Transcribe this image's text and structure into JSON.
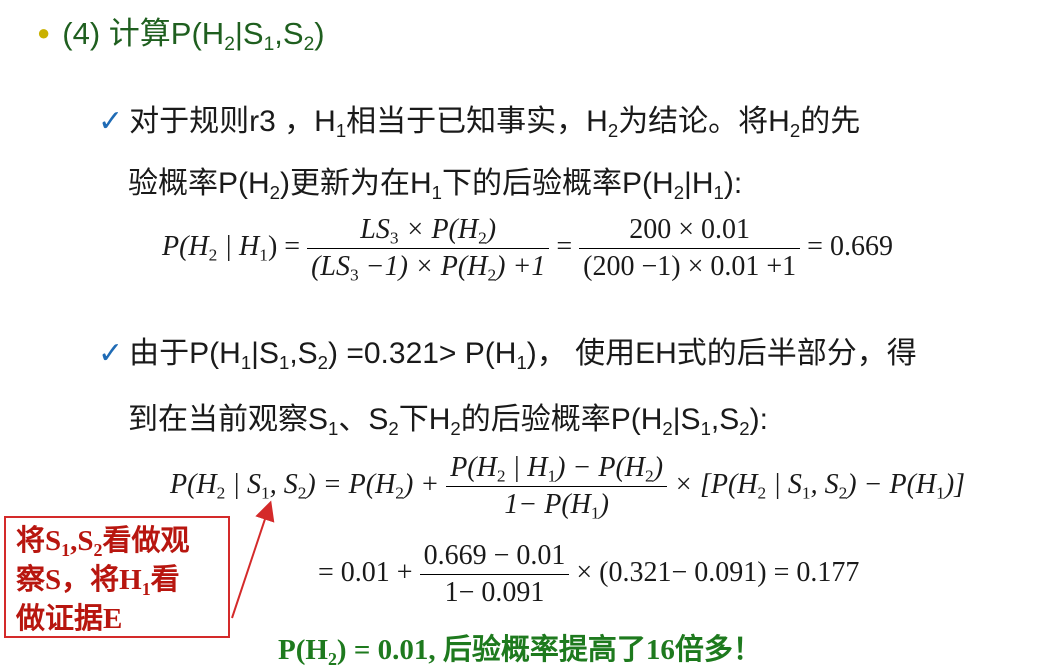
{
  "title": {
    "text_prefix": "(4) 计算P(H",
    "s1": "1",
    "s2": "2",
    "h2": "2",
    "open": "|S",
    "comma": ",S",
    "close": ")"
  },
  "para1": {
    "line1_a": "对于规则r3 ，H",
    "line1_b": "相当于已知事实，H",
    "line1_c": "为结论。将H",
    "line1_d": "的先",
    "line2_a": "验概率P(H",
    "line2_b": ")更新为在H",
    "line2_c": "下的后验概率P(H",
    "line2_d": "|H",
    "line2_e": "):",
    "sub1": "1",
    "sub2": "2"
  },
  "eq1": {
    "lhs": "P(H",
    "lhs_mid": " | H",
    "lhs_end": ") =",
    "num1": "LS",
    "num1_b": " × P(H",
    "num1_c": ")",
    "den1_a": "(LS",
    "den1_b": " −1) × P(H",
    "den1_c": ") +1",
    "eq_sign": "=",
    "num2": "200 × 0.01",
    "den2": "(200 −1) × 0.01 +1",
    "result": "= 0.669",
    "sub3": "3"
  },
  "para2": {
    "line1_a": "由于P(H",
    "line1_b": "|S",
    "line1_c": ",S",
    "line1_d": ") =0.321> P(H",
    "line1_e": ")， 使用EH式的后半部分，得",
    "line2_a": "到在当前观察S",
    "line2_b": "、S",
    "line2_c": "下H",
    "line2_d": "的后验概率P(H",
    "line2_e": "|S",
    "line2_f": ",S",
    "line2_g": "):"
  },
  "eq2": {
    "lhs": "P(H",
    "lhs_b": " | S",
    "lhs_c": ", S",
    "lhs_d": ") = P(H",
    "lhs_e": ") +",
    "num_a": "P(H",
    "num_b": " | H",
    "num_c": ") − P(H",
    "num_d": ")",
    "den_a": "1− P(H",
    "den_b": ")",
    "tail_a": "× [P(H",
    "tail_b": " | S",
    "tail_c": ", S",
    "tail_d": ") − P(H",
    "tail_e": ")]"
  },
  "eq3": {
    "pre": "= 0.01 +",
    "num": "0.669 − 0.01",
    "den": "1− 0.091",
    "post": "× (0.321− 0.091) = 0.177"
  },
  "note": {
    "line1_a": "将S",
    "line1_b": ",S",
    "line1_c": "看做观",
    "line2_a": "察S，将H",
    "line2_b": "看",
    "line3": "做证据E"
  },
  "conclusion": {
    "a": "P(H",
    "b": ") = 0.01, 后验概率提高了16倍多！"
  },
  "colors": {
    "title": "#1f5f1f",
    "check": "#1f6bb5",
    "note_border": "#d42a2a",
    "note_text": "#b8160f",
    "conclusion": "#1e7a1e"
  }
}
